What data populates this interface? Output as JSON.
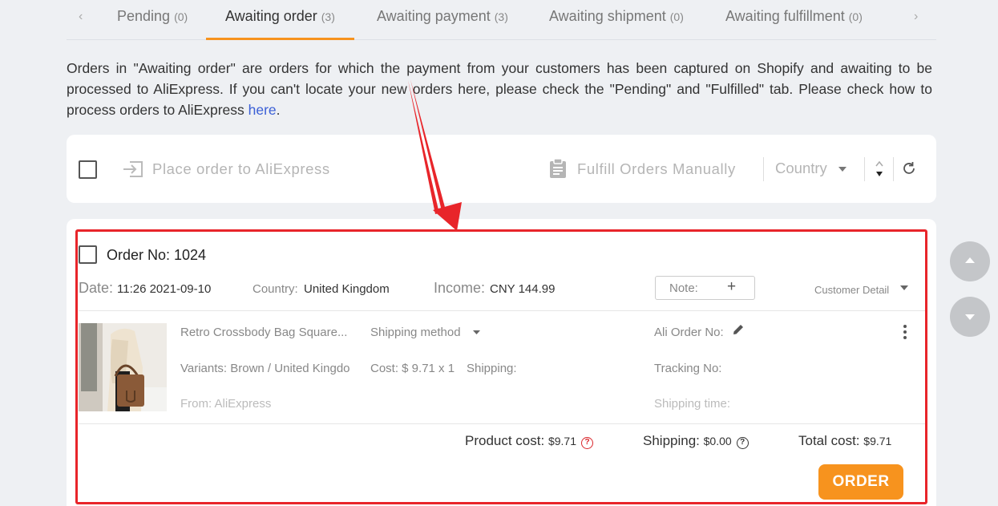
{
  "tabs": [
    {
      "label": "Pending",
      "count": "(0)"
    },
    {
      "label": "Awaiting order",
      "count": "(3)"
    },
    {
      "label": "Awaiting payment",
      "count": "(3)"
    },
    {
      "label": "Awaiting shipment",
      "count": "(0)"
    },
    {
      "label": "Awaiting fulfillment",
      "count": "(0)"
    }
  ],
  "info": {
    "text": "Orders in \"Awaiting order\" are orders for which the payment from your customers has been captured on Shopify and awaiting to be processed to AliExpress. If you can't locate your new orders here, please check the \"Pending\" and \"Fulfilled\" tab. Please check how to process orders to AliExpress ",
    "link": "here",
    "end": "."
  },
  "toolbar": {
    "place_order": "Place order to AliExpress",
    "fulfill_manually": "Fulfill Orders Manually",
    "country_select": "Country"
  },
  "order": {
    "title": "Order No: 1024",
    "date_label": "Date:",
    "date_value": "11:26 2021-09-10",
    "country_label": "Country:",
    "country_value": "United Kingdom",
    "income_label": "Income:",
    "income_value": "CNY 144.99",
    "note_label": "Note:",
    "note_add": "+",
    "customer_detail": "Customer Detail",
    "product": {
      "name": "Retro Crossbody Bag Square...",
      "variants": "Variants: Brown / United Kingdo",
      "from": "From: AliExpress",
      "shipping_method": "Shipping method",
      "cost": "Cost: $ 9.71 x 1",
      "shipping_label": "Shipping:",
      "ali_order_no": "Ali Order No:",
      "tracking_no": "Tracking No:",
      "shipping_time": "Shipping time:"
    },
    "summary": {
      "product_cost_label": "Product cost:",
      "product_cost_value": "$9.71",
      "shipping_label": "Shipping:",
      "shipping_value": "$0.00",
      "total_label": "Total cost:",
      "total_value": "$9.71"
    },
    "order_button": "ORDER"
  },
  "colors": {
    "accent": "#f7931e",
    "annotation_red": "#e8252a",
    "link": "#3a5fd6"
  }
}
